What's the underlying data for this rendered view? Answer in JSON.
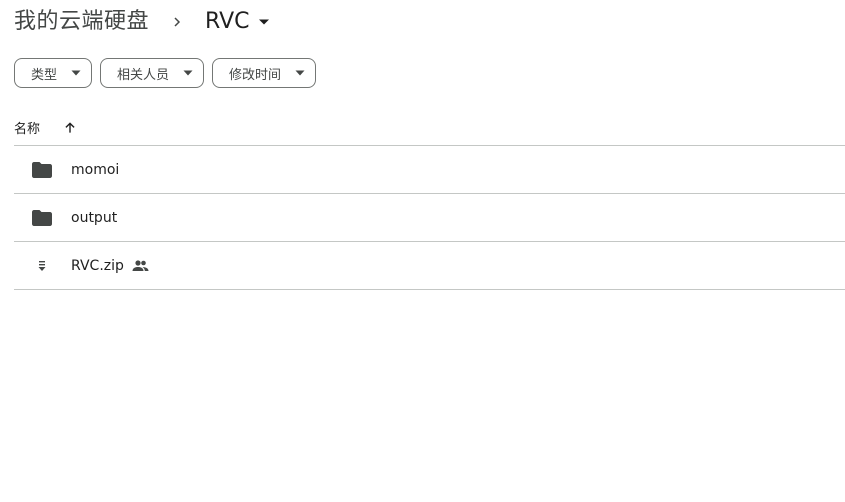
{
  "breadcrumb": {
    "root_label": "我的云端硬盘",
    "separator_icon": "chevron-right-icon",
    "current_label": "RVC",
    "current_caret_icon": "caret-down-icon"
  },
  "filters": [
    {
      "label": "类型",
      "icon": "caret-down-icon"
    },
    {
      "label": "相关人员",
      "icon": "caret-down-icon"
    },
    {
      "label": "修改时间",
      "icon": "caret-down-icon"
    }
  ],
  "list_header": {
    "name_label": "名称",
    "sort_icon": "arrow-up-icon"
  },
  "files": [
    {
      "name": "momoi",
      "icon": "folder-icon",
      "shared": false
    },
    {
      "name": "output",
      "icon": "folder-icon",
      "shared": false
    },
    {
      "name": "RVC.zip",
      "icon": "zip-icon",
      "shared": true,
      "shared_icon": "people-icon"
    }
  ],
  "colors": {
    "text_primary": "#1f1f1f",
    "text_secondary": "#444746",
    "divider": "#c4c7c5",
    "chip_border": "#747775"
  }
}
